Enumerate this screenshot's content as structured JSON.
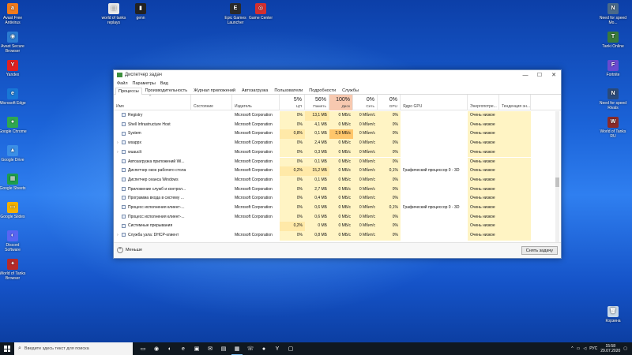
{
  "desktop": {
    "left_icons": [
      {
        "label": "Avast Free Antivirus",
        "color": "#f07a1c",
        "icon": "avast-icon",
        "glyph": "a"
      },
      {
        "label": "Avast Secure Browser",
        "color": "#2b7bd1",
        "icon": "browser-icon",
        "glyph": "◉"
      },
      {
        "label": "Yandex",
        "color": "#e02020",
        "icon": "yandex-icon",
        "glyph": "Y"
      },
      {
        "label": "Microsoft Edge",
        "color": "#1877d6",
        "icon": "edge-icon",
        "glyph": "e"
      },
      {
        "label": "Google Chrome",
        "color": "#2fa84f",
        "icon": "chrome-icon",
        "glyph": "●"
      },
      {
        "label": "Google Drive",
        "color": "#3a8ee6",
        "icon": "drive-icon",
        "glyph": "▲"
      },
      {
        "label": "Google Sheets",
        "color": "#1d9e4c",
        "icon": "sheets-icon",
        "glyph": "▦"
      },
      {
        "label": "Google Slides",
        "color": "#f2b100",
        "icon": "slides-icon",
        "glyph": "▭"
      },
      {
        "label": "Discord Software",
        "color": "#5865f2",
        "icon": "discord-icon",
        "glyph": "◐"
      },
      {
        "label": "World of Tanks Browser",
        "color": "#b52a2a",
        "icon": "tanks-icon",
        "glyph": "✦"
      }
    ],
    "top_icons": [
      {
        "label": "world of tanks replays",
        "color": "#e8e8e8",
        "icon": "file-icon",
        "glyph": "▤"
      },
      {
        "label": "genn",
        "color": "#222222",
        "icon": "app-icon",
        "glyph": "▮"
      },
      {
        "label": "Epic Games Launcher",
        "color": "#2a2a2a",
        "icon": "epic-icon",
        "glyph": "E"
      },
      {
        "label": "Game Center",
        "color": "#d32f2f",
        "icon": "gamecenter-icon",
        "glyph": "◎"
      }
    ],
    "right_icons": [
      {
        "label": "Need for speed Mo...",
        "color": "#4a6a8a",
        "icon": "nfs-icon",
        "glyph": "N"
      },
      {
        "label": "Tanki Online",
        "color": "#3a7a3a",
        "icon": "tanki-icon",
        "glyph": "T"
      },
      {
        "label": "Fortnite",
        "color": "#6a4ad0",
        "icon": "fortnite-icon",
        "glyph": "F"
      },
      {
        "label": "Need for speed Rivals",
        "color": "#2a4a7a",
        "icon": "nfs-rivals-icon",
        "glyph": "N"
      },
      {
        "label": "World of Tanks RU",
        "color": "#8a2a2a",
        "icon": "wot-icon",
        "glyph": "W"
      },
      {
        "label": "Корзина",
        "color": "#c8d8e8",
        "icon": "recycle-bin-icon",
        "glyph": "🗑"
      }
    ]
  },
  "window": {
    "title": "Диспетчер задач",
    "controls": {
      "minimize": "—",
      "maximize": "☐",
      "close": "✕"
    },
    "menu": [
      "Файл",
      "Параметры",
      "Вид"
    ],
    "tabs": [
      "Процессы",
      "Производительность",
      "Журнал приложений",
      "Автозагрузка",
      "Пользователи",
      "Подробности",
      "Службы"
    ],
    "header": {
      "name": "Имя",
      "status": "Состояние",
      "publisher": "Издатель",
      "cpu_pct": "5%",
      "cpu": "ЦП",
      "mem_pct": "56%",
      "mem": "Память",
      "disk_pct": "100%",
      "disk": "Диск",
      "net_pct": "0%",
      "net": "Сеть",
      "gpu_pct": "0%",
      "gpu": "GPU",
      "gpu_engine": "Ядро GPU",
      "power": "Энергопотре...",
      "power_trend": "Тенденция эн..."
    },
    "rows": [
      {
        "expand": "",
        "name": "Registry",
        "publisher": "Microsoft Corporation",
        "cpu": "0%",
        "mem": "13,1 МБ",
        "disk": "0 МБ/с",
        "net": "0 Мбит/с",
        "gpu": "0%",
        "engine": "",
        "power": "Очень низкое"
      },
      {
        "expand": "",
        "name": "Shell Infrastructure Host",
        "publisher": "Microsoft Corporation",
        "cpu": "0%",
        "mem": "4,1 МБ",
        "disk": "0 МБ/с",
        "net": "0 Мбит/с",
        "gpu": "0%",
        "engine": "",
        "power": "Очень низкое"
      },
      {
        "expand": "",
        "name": "System",
        "publisher": "Microsoft Corporation",
        "cpu": "0,8%",
        "mem": "0,1 МБ",
        "disk": "2,9 МБ/с",
        "net": "0 Мбит/с",
        "gpu": "0%",
        "engine": "",
        "power": "Очень низкое"
      },
      {
        "expand": "›",
        "name": "wsappx",
        "publisher": "Microsoft Corporation",
        "cpu": "0%",
        "mem": "2,4 МБ",
        "disk": "0 МБ/с",
        "net": "0 Мбит/с",
        "gpu": "0%",
        "engine": "",
        "power": "Очень низкое"
      },
      {
        "expand": "›",
        "name": "wuauclt",
        "publisher": "Microsoft Corporation",
        "cpu": "0%",
        "mem": "0,3 МБ",
        "disk": "0 МБ/с",
        "net": "0 Мбит/с",
        "gpu": "0%",
        "engine": "",
        "power": "Очень низкое"
      },
      {
        "expand": "",
        "name": "Автозагрузка приложений Wi...",
        "publisher": "Microsoft Corporation",
        "cpu": "0%",
        "mem": "0,1 МБ",
        "disk": "0 МБ/с",
        "net": "0 Мбит/с",
        "gpu": "0%",
        "engine": "",
        "power": "Очень низкое"
      },
      {
        "expand": "",
        "name": "Диспетчер окон рабочего стола",
        "publisher": "Microsoft Corporation",
        "cpu": "0,2%",
        "mem": "15,2 МБ",
        "disk": "0 МБ/с",
        "net": "0 Мбит/с",
        "gpu": "0,1%",
        "engine": "Графический процессор 0 - 3D",
        "power": "Очень низкое"
      },
      {
        "expand": "",
        "name": "Диспетчер сеанса Windows",
        "publisher": "Microsoft Corporation",
        "cpu": "0%",
        "mem": "0,1 МБ",
        "disk": "0 МБ/с",
        "net": "0 Мбит/с",
        "gpu": "0%",
        "engine": "",
        "power": "Очень низкое"
      },
      {
        "expand": "",
        "name": "Приложение служб и контрол...",
        "publisher": "Microsoft Corporation",
        "cpu": "0%",
        "mem": "2,7 МБ",
        "disk": "0 МБ/с",
        "net": "0 Мбит/с",
        "gpu": "0%",
        "engine": "",
        "power": "Очень низкое"
      },
      {
        "expand": "",
        "name": "Программа входа в систему ...",
        "publisher": "Microsoft Corporation",
        "cpu": "0%",
        "mem": "0,4 МБ",
        "disk": "0 МБ/с",
        "net": "0 Мбит/с",
        "gpu": "0%",
        "engine": "",
        "power": "Очень низкое"
      },
      {
        "expand": "",
        "name": "Процесс исполнения клиент-...",
        "publisher": "Microsoft Corporation",
        "cpu": "0%",
        "mem": "0,6 МБ",
        "disk": "0 МБ/с",
        "net": "0 Мбит/с",
        "gpu": "0,1%",
        "engine": "Графический процессор 0 - 3D",
        "power": "Очень низкое"
      },
      {
        "expand": "",
        "name": "Процесс исполнения клиент-...",
        "publisher": "Microsoft Corporation",
        "cpu": "0%",
        "mem": "0,6 МБ",
        "disk": "0 МБ/с",
        "net": "0 Мбит/с",
        "gpu": "0%",
        "engine": "",
        "power": "Очень низкое"
      },
      {
        "expand": "",
        "name": "Системные прерывания",
        "publisher": "",
        "cpu": "0,2%",
        "mem": "0 МБ",
        "disk": "0 МБ/с",
        "net": "0 Мбит/с",
        "gpu": "0%",
        "engine": "",
        "power": "Очень низкое"
      },
      {
        "expand": "›",
        "name": "Служба узла: DHCP-клиент",
        "publisher": "Microsoft Corporation",
        "cpu": "0%",
        "mem": "0,8 МБ",
        "disk": "0 МБ/с",
        "net": "0 Мбит/с",
        "gpu": "0%",
        "engine": "",
        "power": "Очень низкое"
      }
    ],
    "footer": {
      "less": "Меньше",
      "end_task": "Снять задачу"
    }
  },
  "taskbar": {
    "search_placeholder": "Введите здесь текст для поиска",
    "apps": [
      "task-view-icon",
      "firefox-icon",
      "browser-icon",
      "edge-icon",
      "store-icon",
      "mail-icon",
      "explorer-icon",
      "taskmgr-icon",
      "viber-icon",
      "chrome-icon",
      "yandex-icon",
      "window-icon"
    ],
    "language": "РУС",
    "time": "15:58",
    "date": "29.07.2020"
  },
  "colors": {
    "accent": "#1b63d8",
    "disk_header": "#f7c9b0",
    "heat_low": "#fff4c4",
    "heat_high": "#ffc66b"
  }
}
